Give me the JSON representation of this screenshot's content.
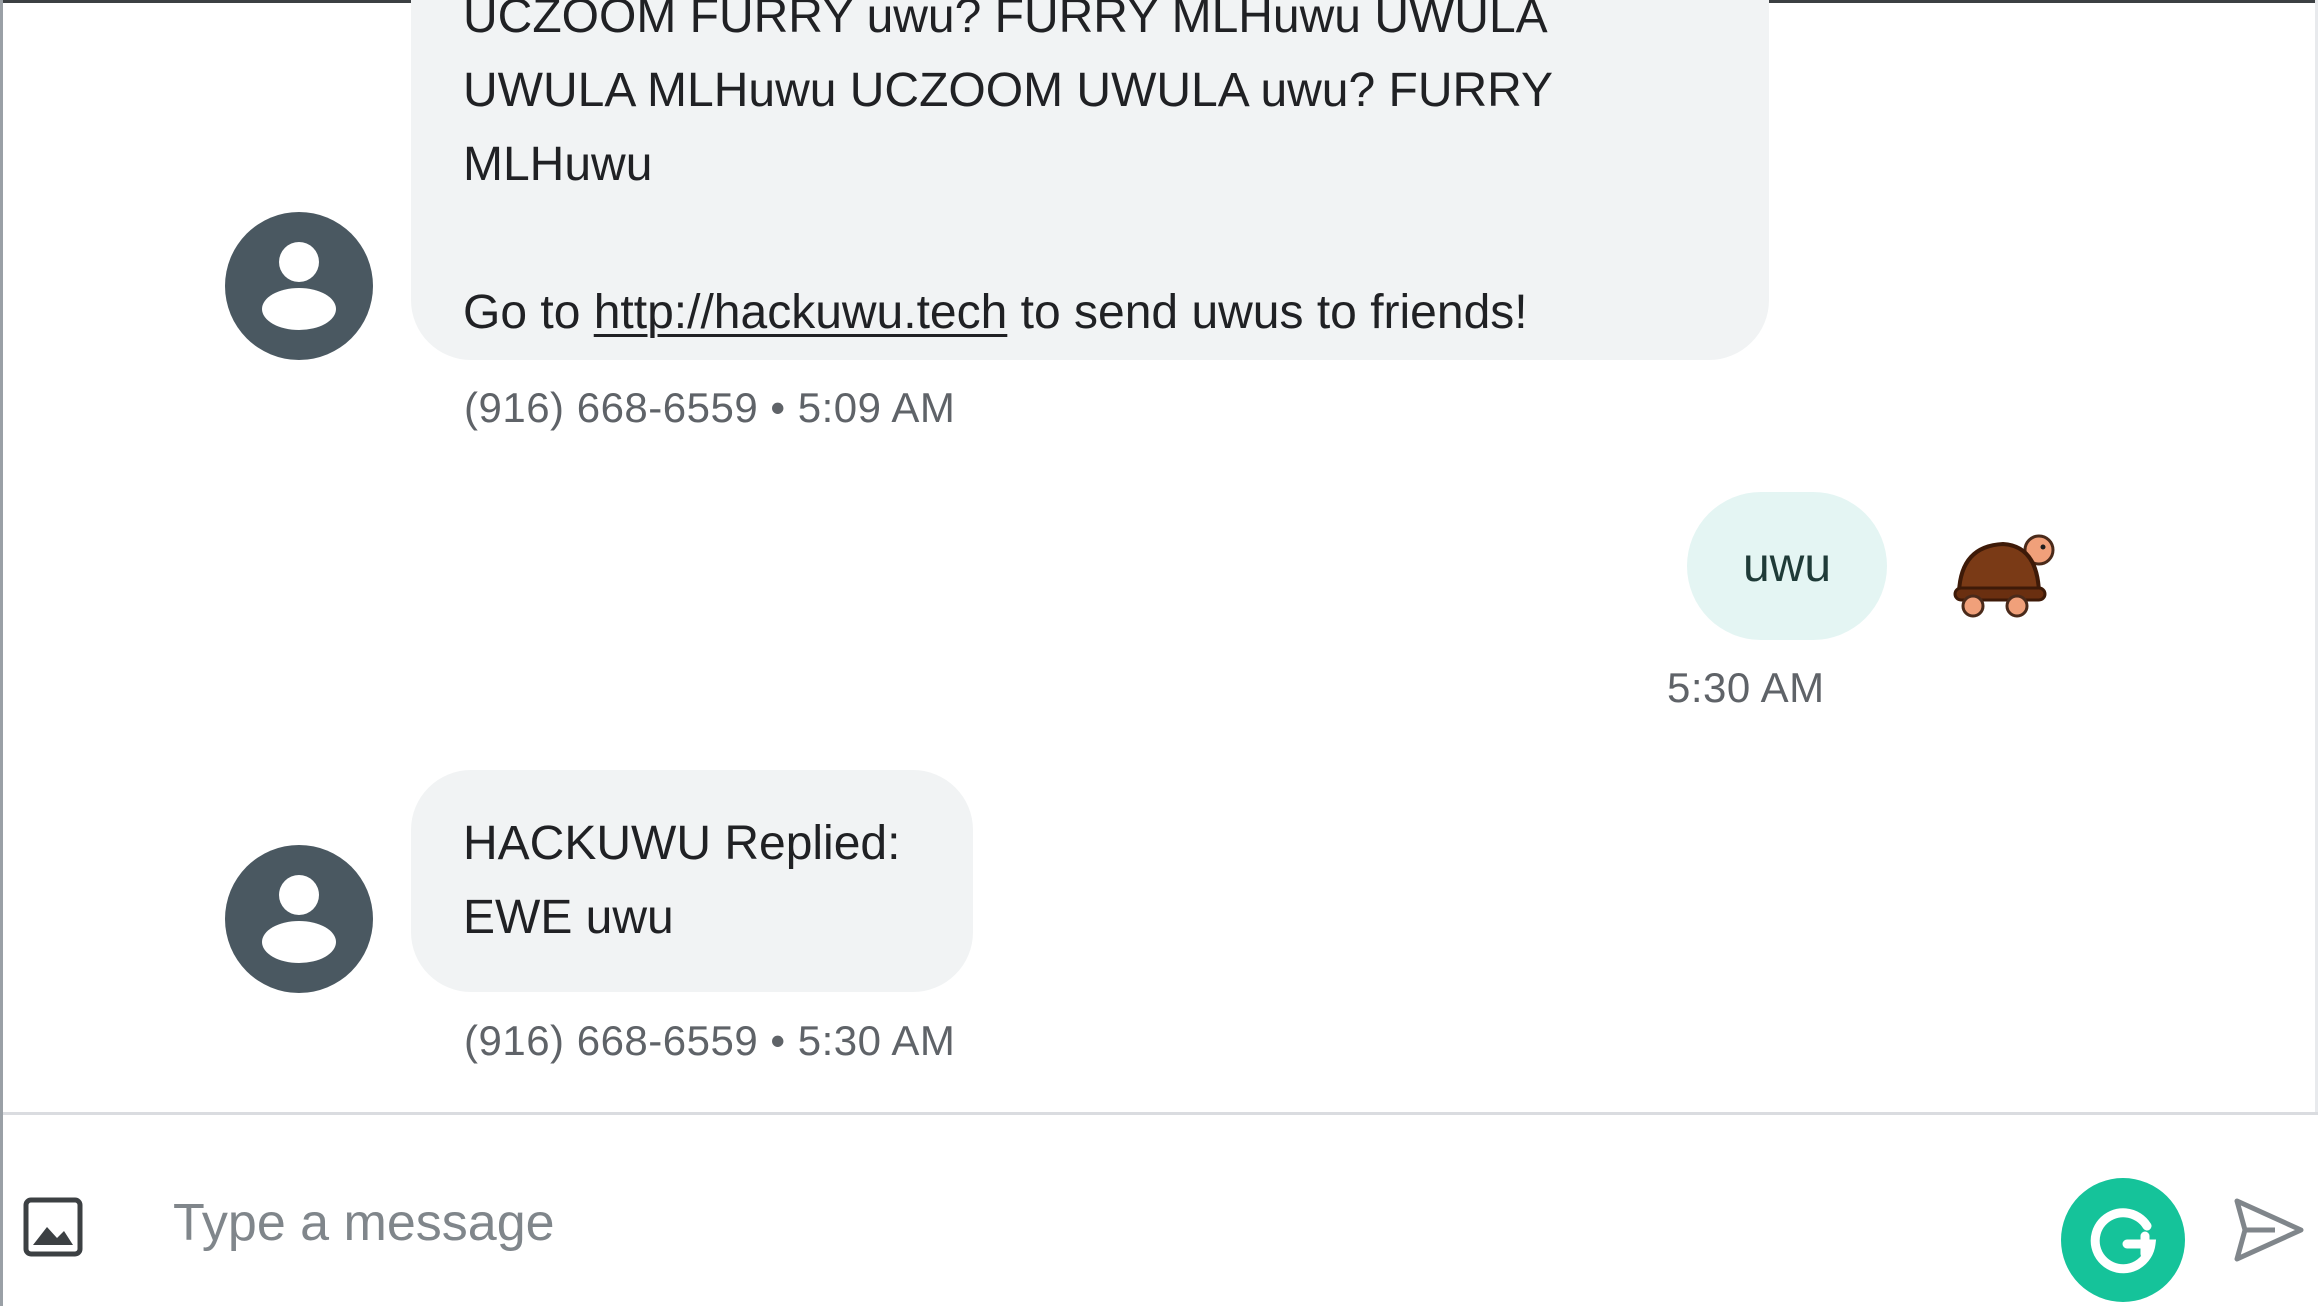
{
  "conversation": {
    "messages": [
      {
        "direction": "incoming",
        "lines": [
          "UCZOOM FURRY uwu? FURRY MLHuwu UWULA",
          "UWULA MLHuwu UCZOOM UWULA uwu? FURRY",
          "MLHuwu"
        ],
        "link_prefix": "Go to ",
        "link_text": "http://hackuwu.tech",
        "link_suffix": " to send uwus to friends!",
        "sender": "(916) 668-6559",
        "time": "5:09 AM",
        "meta": "(916) 668-6559 • 5:09 AM"
      },
      {
        "direction": "outgoing",
        "text": "uwu",
        "time": "5:30 AM",
        "sticker": "turtle-sticker-icon"
      },
      {
        "direction": "incoming",
        "lines": [
          "HACKUWU Replied:",
          "EWE uwu"
        ],
        "sender": "(916) 668-6559",
        "time": "5:30 AM",
        "meta": "(916) 668-6559 • 5:30 AM"
      }
    ]
  },
  "composer": {
    "placeholder": "Type a message",
    "value": "",
    "attach_icon": "image-icon",
    "grammarly_icon": "grammarly-icon",
    "send_icon": "send-icon"
  },
  "colors": {
    "incoming_bubble": "#f1f3f4",
    "outgoing_bubble": "#e4f5f3",
    "avatar": "#4a5861",
    "grammarly": "#15c39a",
    "meta_text": "#5f6368"
  }
}
